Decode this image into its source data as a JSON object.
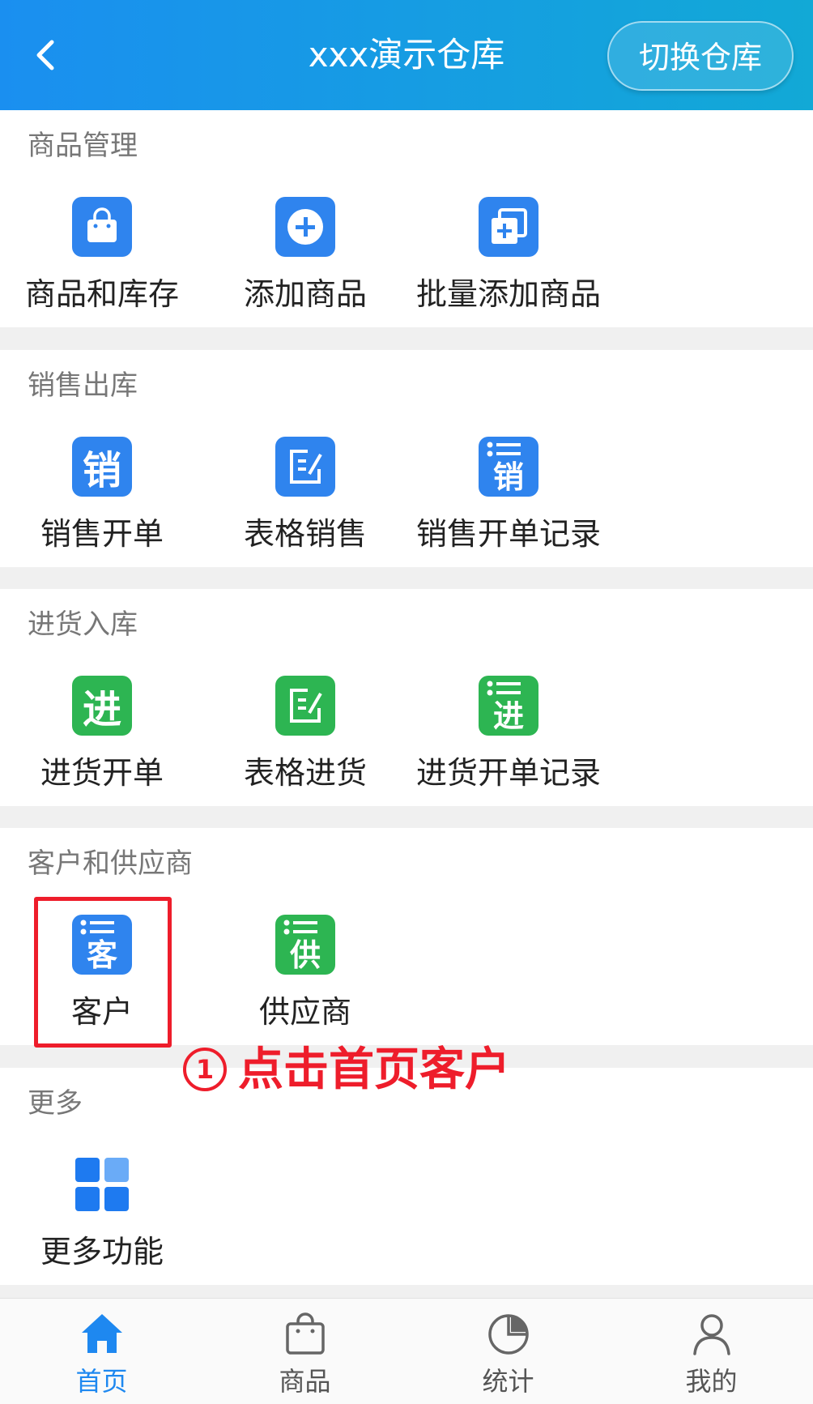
{
  "header": {
    "title": "xxx演示仓库",
    "switch_button": "切换仓库"
  },
  "sections": [
    {
      "title": "商品管理",
      "items": [
        {
          "label": "商品和库存",
          "icon": "shopping-bag-icon"
        },
        {
          "label": "添加商品",
          "icon": "plus-circle-icon"
        },
        {
          "label": "批量添加商品",
          "icon": "batch-add-icon"
        }
      ]
    },
    {
      "title": "销售出库",
      "items": [
        {
          "label": "销售开单",
          "icon": "sales-char-icon",
          "glyph": "销"
        },
        {
          "label": "表格销售",
          "icon": "edit-form-icon"
        },
        {
          "label": "销售开单记录",
          "icon": "sales-list-icon",
          "glyph": "销"
        }
      ]
    },
    {
      "title": "进货入库",
      "items": [
        {
          "label": "进货开单",
          "icon": "purchase-char-icon",
          "glyph": "进"
        },
        {
          "label": "表格进货",
          "icon": "edit-form-icon"
        },
        {
          "label": "进货开单记录",
          "icon": "purchase-list-icon",
          "glyph": "进"
        }
      ]
    },
    {
      "title": "客户和供应商",
      "items": [
        {
          "label": "客户",
          "icon": "customer-list-icon",
          "glyph": "客"
        },
        {
          "label": "供应商",
          "icon": "supplier-list-icon",
          "glyph": "供"
        }
      ]
    },
    {
      "title": "更多",
      "items": [
        {
          "label": "更多功能",
          "icon": "grid-icon"
        }
      ]
    }
  ],
  "annotation": {
    "number": "1",
    "text": "点击首页客户"
  },
  "tabbar": [
    {
      "label": "首页",
      "icon": "home-icon",
      "active": true
    },
    {
      "label": "商品",
      "icon": "shopping-bag-icon",
      "active": false
    },
    {
      "label": "统计",
      "icon": "pie-chart-icon",
      "active": false
    },
    {
      "label": "我的",
      "icon": "user-icon",
      "active": false
    }
  ],
  "colors": {
    "header_start": "#1a8ff0",
    "header_end": "#12a9d6",
    "icon_blue": "#2f84ee",
    "icon_green": "#2db552",
    "annotation_red": "#ee1d2b",
    "tab_active": "#1e88f0"
  }
}
